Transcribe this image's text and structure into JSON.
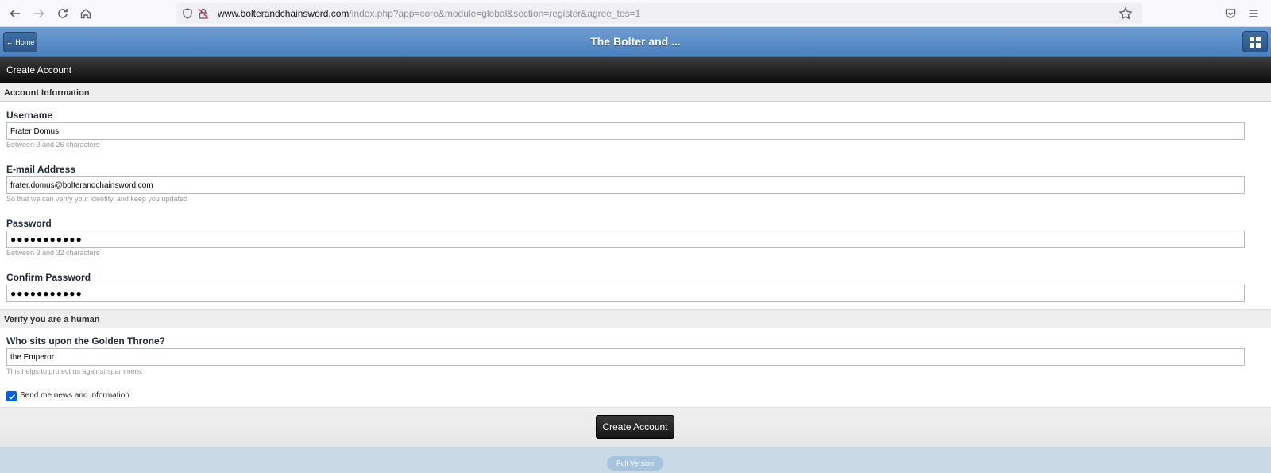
{
  "browser": {
    "url_domain": "www.bolterandchainsword.com",
    "url_path": "/index.php?app=core&module=global&section=register&agree_tos=1"
  },
  "header": {
    "home_label": "← Home",
    "title": "The Bolter and ..."
  },
  "page": {
    "title": "Create Account"
  },
  "account_section": {
    "title": "Account Information",
    "username": {
      "label": "Username",
      "value": "Frater Domus",
      "hint": "Between 3 and 26 characters"
    },
    "email": {
      "label": "E-mail Address",
      "value": "frater.domus@bolterandchainsword.com",
      "hint": "So that we can verify your identity, and keep you updated"
    },
    "password": {
      "label": "Password",
      "value": "●●●●●●●●●●●",
      "hint": "Between 3 and 32 characters"
    },
    "confirm_password": {
      "label": "Confirm Password",
      "value": "●●●●●●●●●●●"
    }
  },
  "human_section": {
    "title": "Verify you are a human",
    "question": {
      "label": "Who sits upon the Golden Throne?",
      "value": "the Emperor",
      "hint": "This helps to protect us against spammers."
    }
  },
  "news_checkbox": {
    "label": "Send me news and information",
    "checked": true
  },
  "submit": {
    "label": "Create Account"
  },
  "footer": {
    "full_version_label": "Full Version"
  },
  "colors": {
    "header_blue": "#4b80bd",
    "page_header_black": "#0c0c0c",
    "checkbox_blue": "#0060df"
  }
}
